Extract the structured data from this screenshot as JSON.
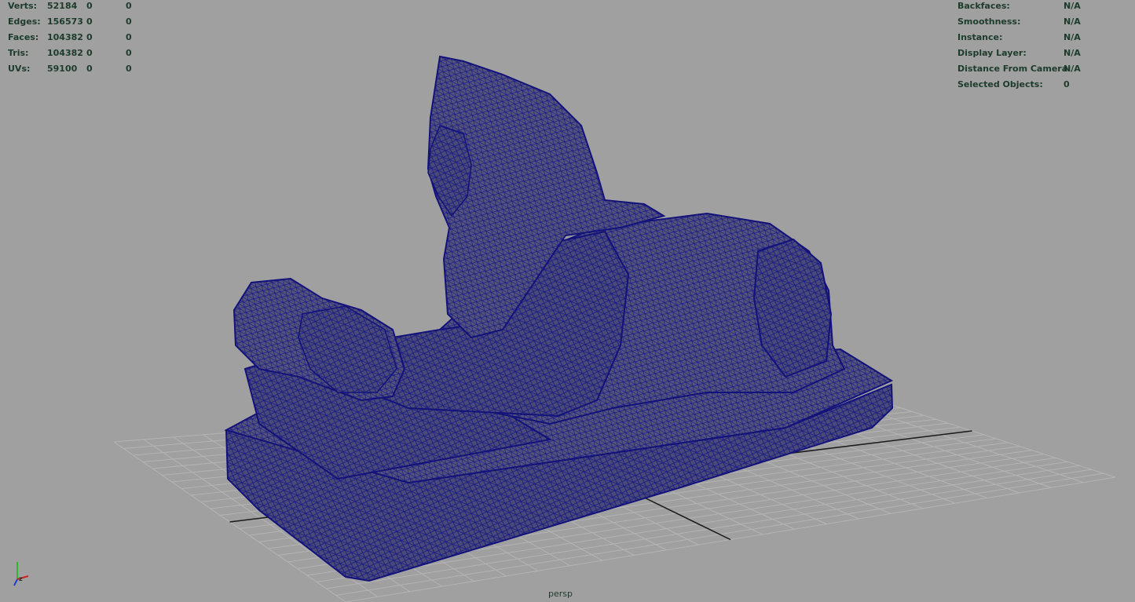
{
  "heads_up_left": {
    "rows": [
      {
        "label": "Verts:",
        "v1": "52184",
        "v2": "0",
        "v3": "0"
      },
      {
        "label": "Edges:",
        "v1": "156573",
        "v2": "0",
        "v3": "0"
      },
      {
        "label": "Faces:",
        "v1": "104382",
        "v2": "0",
        "v3": "0"
      },
      {
        "label": "Tris:",
        "v1": "104382",
        "v2": "0",
        "v3": "0"
      },
      {
        "label": "UVs:",
        "v1": "59100",
        "v2": "0",
        "v3": "0"
      }
    ]
  },
  "heads_up_right": {
    "rows": [
      {
        "label": "Backfaces:",
        "value": "N/A"
      },
      {
        "label": "Smoothness:",
        "value": "N/A"
      },
      {
        "label": "Instance:",
        "value": "N/A"
      },
      {
        "label": "Display Layer:",
        "value": "N/A"
      },
      {
        "label": "Distance From Camera:",
        "value": "N/A"
      },
      {
        "label": "Selected Objects:",
        "value": "0"
      }
    ]
  },
  "camera_label": "persp",
  "colors": {
    "viewport_bg": "#a0a0a0",
    "hud_text": "#1d3b2b",
    "grid": "#b4b4b4",
    "grid_axis": "#1a1a1a",
    "wireframe": "#1a1a7a",
    "mesh_fill": "#3a3a70"
  },
  "icons": [
    "axis-gizmo-icon"
  ]
}
